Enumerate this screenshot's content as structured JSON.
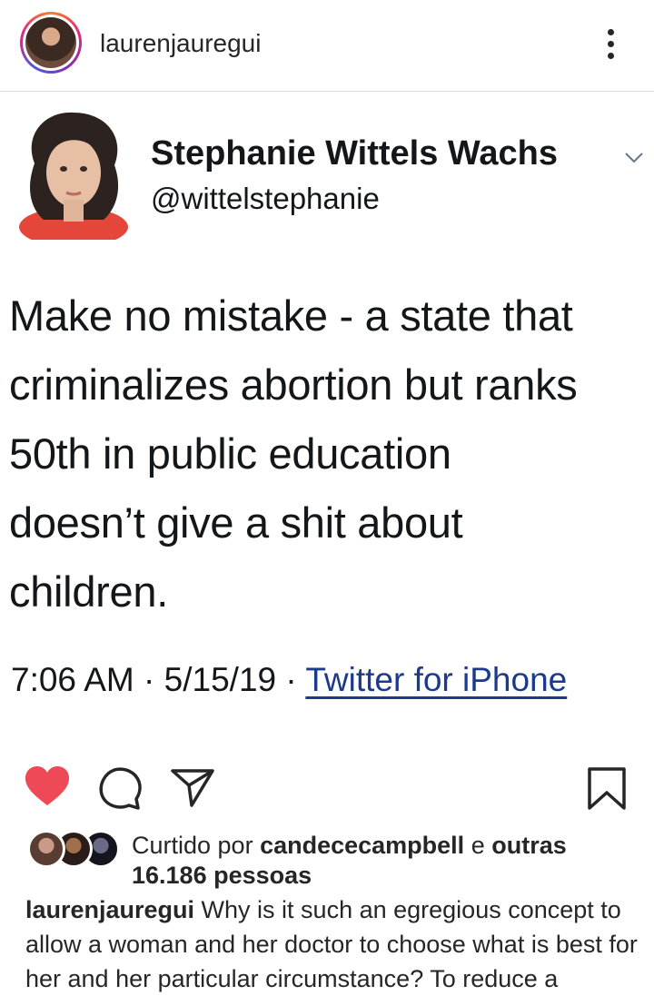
{
  "header": {
    "username": "laurenjauregui"
  },
  "tweet": {
    "display_name": "Stephanie Wittels Wachs",
    "handle": "@wittelstephanie",
    "text_lines": [
      "Make no mistake - a state that",
      "criminalizes abortion but ranks",
      "50th in public education",
      "doesn’t give a shit about",
      "children."
    ],
    "time": "7:06 AM",
    "date": "5/15/19",
    "separator": " · ",
    "source": "Twitter for iPhone"
  },
  "actions": {
    "liked": true,
    "icons": [
      "heart-icon",
      "comment-icon",
      "share-icon",
      "bookmark-icon"
    ]
  },
  "likes": {
    "prefix": "Curtido por ",
    "user": "candececampbell",
    "middle": " e ",
    "others": "outras 16.186 pessoas"
  },
  "caption": {
    "username": "laurenjauregui",
    "text": " Why is it such an egregious concept to allow a woman and her doctor to choose what is best for her and her particular circumstance? To reduce a"
  },
  "colors": {
    "heart": "#ed4956",
    "link": "#1b3a8c",
    "text": "#262626",
    "tweet_text": "#14171a"
  }
}
